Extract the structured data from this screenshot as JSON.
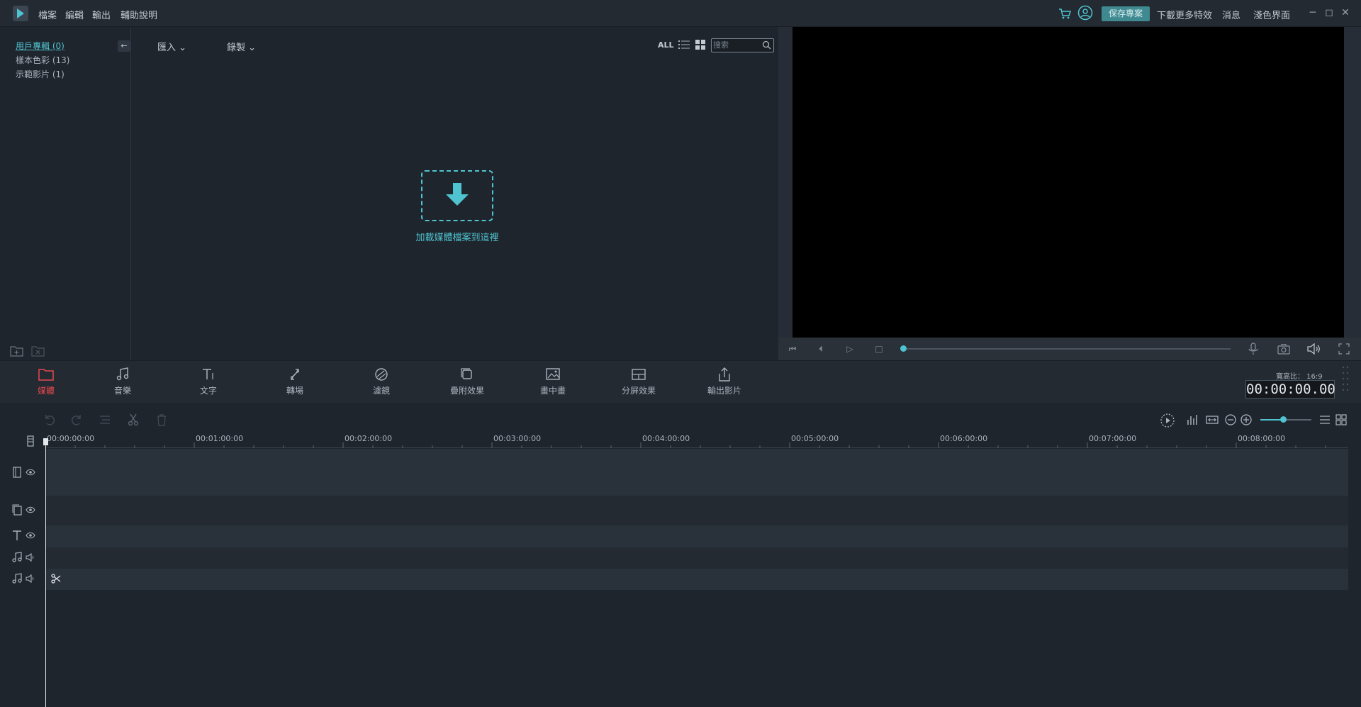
{
  "title_bar": {
    "menu": [
      "檔案",
      "編輯",
      "輸出",
      "輔助說明"
    ],
    "save_project": "保存專案",
    "download_more_effects": "下載更多特效",
    "messages": "消息",
    "light_ui": "淺色界面",
    "window_controls": [
      "─",
      "◻",
      "✕"
    ]
  },
  "library": {
    "items": [
      "用戶專輯 (0)",
      "樣本色彩 (13)",
      "示範影片 (1)"
    ],
    "collapse": "←",
    "import": "匯入 ⌄",
    "record": "錄製 ⌄",
    "filter_all": "ALL",
    "search_placeholder": "搜索",
    "drop_label": "加載媒體檔案到這裡"
  },
  "tools": [
    {
      "label": "媒體",
      "icon": "folder-icon"
    },
    {
      "label": "音樂",
      "icon": "music-icon"
    },
    {
      "label": "文字",
      "icon": "text-icon"
    },
    {
      "label": "轉場",
      "icon": "transition-icon"
    },
    {
      "label": "濾鏡",
      "icon": "filter-icon"
    },
    {
      "label": "疊附效果",
      "icon": "overlay-icon"
    },
    {
      "label": "畫中畫",
      "icon": "pip-icon"
    },
    {
      "label": "分屏效果",
      "icon": "split-screen-icon"
    },
    {
      "label": "輸出影片",
      "icon": "export-icon"
    }
  ],
  "preview": {
    "aspect_ratio": "寬高比： 16:9",
    "timecode": "00:00:00.00",
    "progress": 0
  },
  "timeline": {
    "ticks": [
      "00:00:00:00",
      "00:01:00:00",
      "00:02:00:00",
      "00:03:00:00",
      "00:04:00:00",
      "00:05:00:00",
      "00:06:00:00",
      "00:07:00:00",
      "00:08:00:00"
    ],
    "tracks": [
      "video",
      "overlay",
      "text",
      "music",
      "music"
    ],
    "zoom_level": 0.47
  },
  "colors": {
    "accent": "#4fc3d0",
    "active_tool": "#e8484f",
    "background": "#1f252d"
  }
}
